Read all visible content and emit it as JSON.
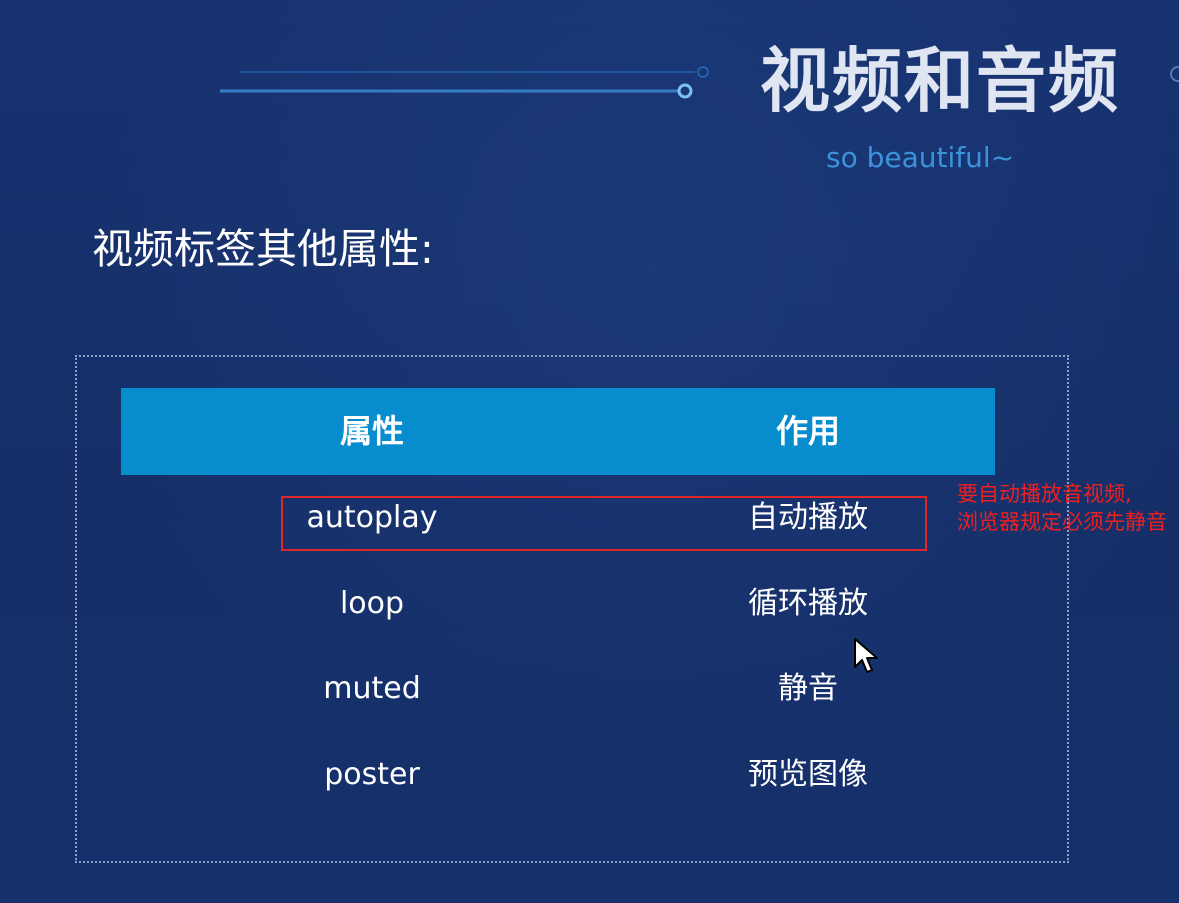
{
  "slide": {
    "title": "视频和音频",
    "subtitle": "so beautiful~",
    "section_heading": "视频标签其他属性:"
  },
  "table": {
    "headers": [
      "属性",
      "作用"
    ],
    "rows": [
      [
        "autoplay",
        "自动播放"
      ],
      [
        "loop",
        "循环播放"
      ],
      [
        "muted",
        "静音"
      ],
      [
        "poster",
        "预览图像"
      ]
    ]
  },
  "annotation": {
    "line1": "要自动播放音视频,",
    "line2": "浏览器规定必须先静音"
  },
  "colors": {
    "background": "#16306a",
    "table_header": "#078ccd",
    "subtitle": "#3c93d9",
    "highlight": "#e02626",
    "annotation": "#f01f1f"
  },
  "icons": {
    "cursor": "mouse-pointer-icon",
    "decoration": "circuit-line-decoration"
  }
}
